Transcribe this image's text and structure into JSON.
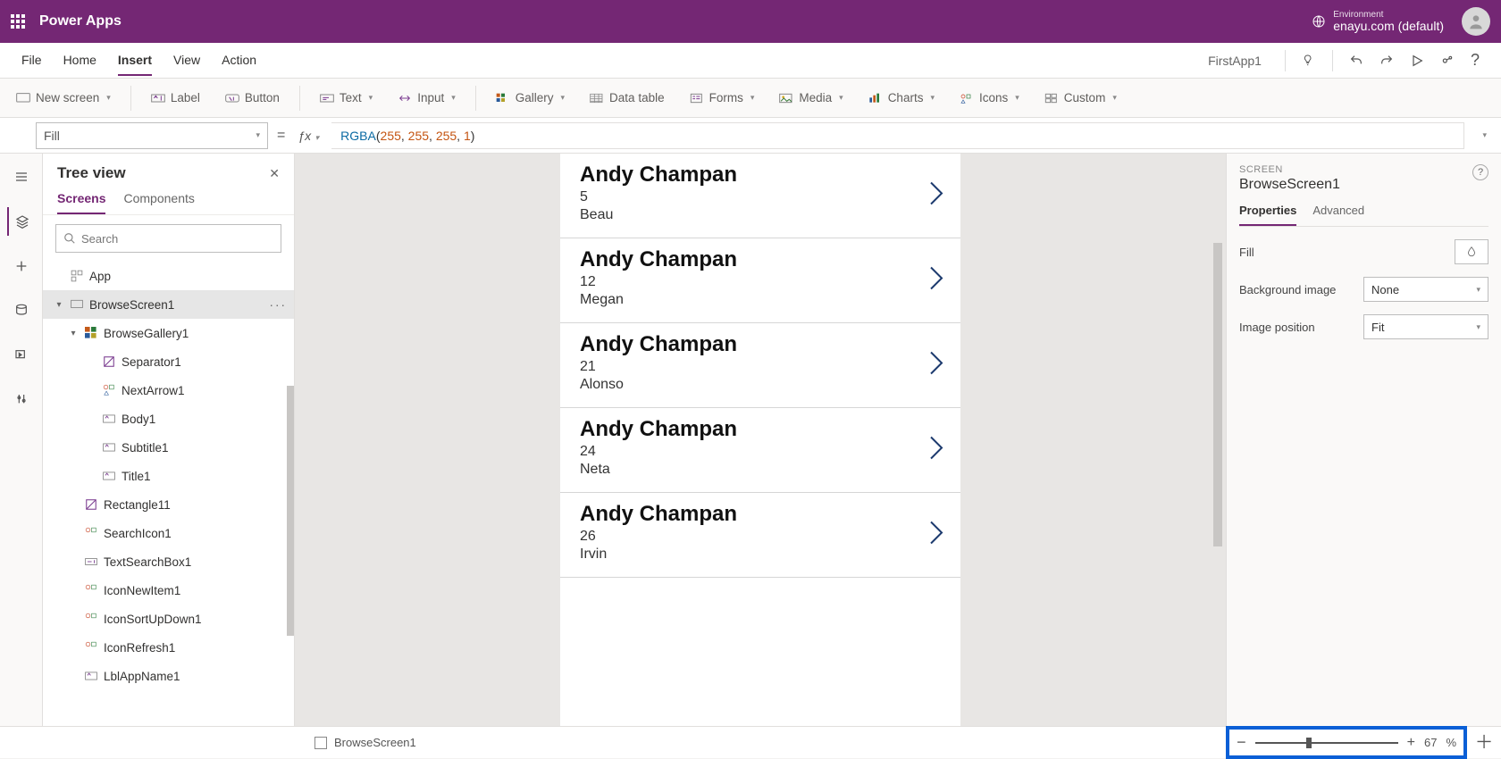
{
  "header": {
    "app_title": "Power Apps",
    "env_label": "Environment",
    "env_name": "enayu.com (default)"
  },
  "menu": {
    "items": [
      "File",
      "Home",
      "Insert",
      "View",
      "Action"
    ],
    "active": "Insert",
    "app_name": "FirstApp1"
  },
  "ribbon": {
    "new_screen": "New screen",
    "label": "Label",
    "button": "Button",
    "text": "Text",
    "input": "Input",
    "gallery": "Gallery",
    "data_table": "Data table",
    "forms": "Forms",
    "media": "Media",
    "charts": "Charts",
    "icons": "Icons",
    "custom": "Custom"
  },
  "formula": {
    "property": "Fill",
    "fn": "RGBA",
    "args": [
      "255",
      "255",
      "255",
      "1"
    ]
  },
  "tree": {
    "title": "Tree view",
    "tabs": {
      "screens": "Screens",
      "components": "Components"
    },
    "search_placeholder": "Search",
    "app": "App",
    "nodes": [
      {
        "name": "BrowseScreen1",
        "selected": true
      },
      {
        "name": "BrowseGallery1"
      },
      {
        "name": "Separator1"
      },
      {
        "name": "NextArrow1"
      },
      {
        "name": "Body1"
      },
      {
        "name": "Subtitle1"
      },
      {
        "name": "Title1"
      },
      {
        "name": "Rectangle11"
      },
      {
        "name": "SearchIcon1"
      },
      {
        "name": "TextSearchBox1"
      },
      {
        "name": "IconNewItem1"
      },
      {
        "name": "IconSortUpDown1"
      },
      {
        "name": "IconRefresh1"
      },
      {
        "name": "LblAppName1"
      }
    ]
  },
  "gallery": [
    {
      "title": "Andy Champan",
      "subtitle": "5",
      "body": "Beau"
    },
    {
      "title": "Andy Champan",
      "subtitle": "12",
      "body": "Megan"
    },
    {
      "title": "Andy Champan",
      "subtitle": "21",
      "body": "Alonso"
    },
    {
      "title": "Andy Champan",
      "subtitle": "24",
      "body": "Neta"
    },
    {
      "title": "Andy Champan",
      "subtitle": "26",
      "body": "Irvin"
    }
  ],
  "props": {
    "kind": "SCREEN",
    "name": "BrowseScreen1",
    "tabs": {
      "properties": "Properties",
      "advanced": "Advanced"
    },
    "rows": {
      "fill": "Fill",
      "bg_image": "Background image",
      "bg_image_value": "None",
      "img_pos": "Image position",
      "img_pos_value": "Fit"
    }
  },
  "status": {
    "screen_name": "BrowseScreen1",
    "zoom_value": "67",
    "zoom_unit": "%"
  }
}
